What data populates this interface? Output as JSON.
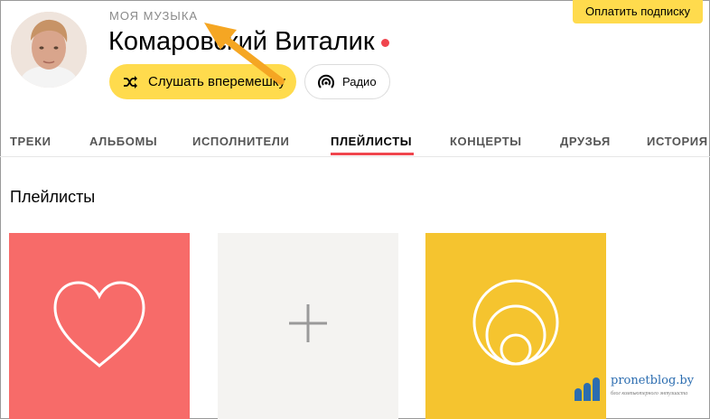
{
  "header": {
    "subscribe_label": "Оплатить подписку",
    "section_label": "МОЯ МУЗЫКА",
    "user_name": "Комаровский Виталик",
    "online_status_color": "#f0454e",
    "shuffle_label": "Слушать вперемешку",
    "shuffle_icon": "shuffle-icon",
    "radio_label": "Радио",
    "radio_icon": "radio-wave-icon"
  },
  "tabs": [
    {
      "label": "ТРЕКИ",
      "active": false
    },
    {
      "label": "АЛЬБОМЫ",
      "active": false
    },
    {
      "label": "ИСПОЛНИТЕЛИ",
      "active": false
    },
    {
      "label": "ПЛЕЙЛИСТЫ",
      "active": true
    },
    {
      "label": "КОНЦЕРТЫ",
      "active": false
    },
    {
      "label": "ДРУЗЬЯ",
      "active": false
    },
    {
      "label": "ИСТОРИЯ",
      "active": false
    }
  ],
  "main": {
    "section_title": "Плейлисты",
    "playlists": [
      {
        "icon": "heart-icon",
        "color": "#f76b69"
      },
      {
        "icon": "plus-icon",
        "color": "#f4f3f1"
      },
      {
        "icon": "concentric-circles-icon",
        "color": "#f5c42f"
      }
    ]
  },
  "watermark": {
    "brand": "pronetblog.by",
    "tagline": "блог компьютерного энтузиаста"
  },
  "colors": {
    "accent_yellow": "#ffdb4d",
    "active_tab_underline": "#f0454e",
    "annotation_arrow": "#f5a623"
  }
}
